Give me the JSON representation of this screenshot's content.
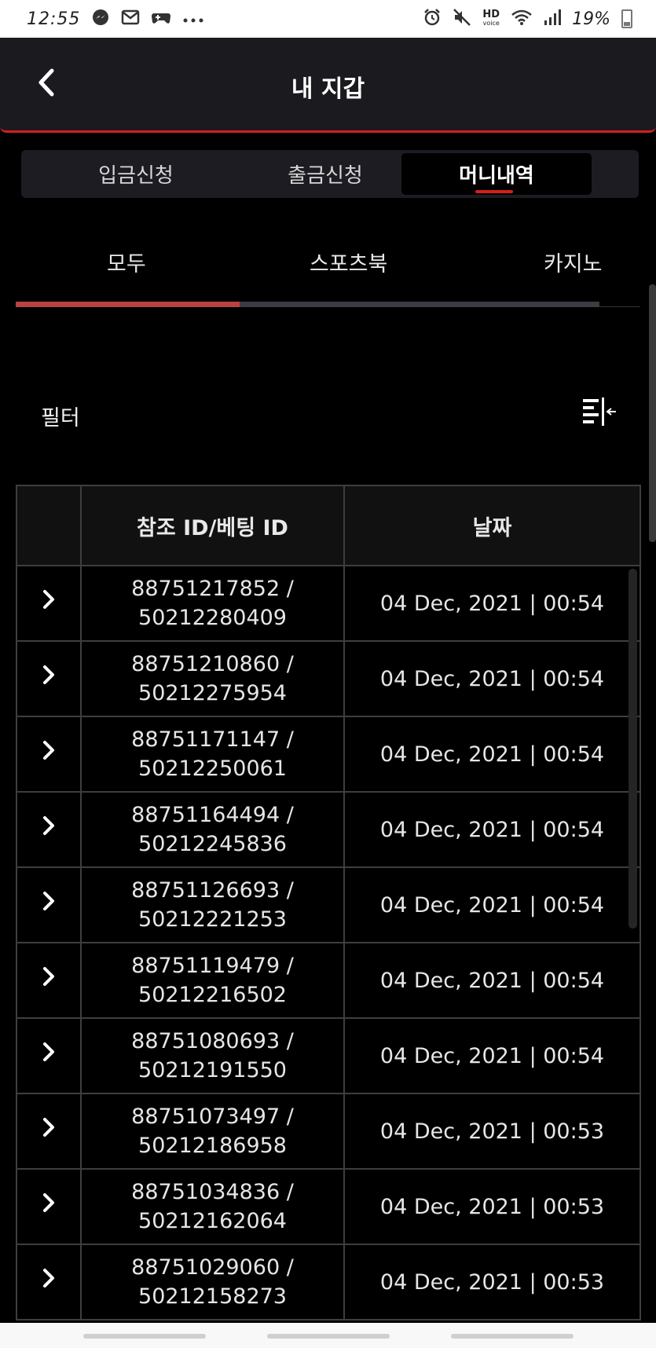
{
  "status_bar": {
    "time": "12:55",
    "hd_label": "HD",
    "voice_label": "voice",
    "battery": "19%"
  },
  "header": {
    "title": "내 지갑"
  },
  "top_tabs": {
    "deposit": "입금신청",
    "withdraw": "출금신청",
    "money_history": "머니내역",
    "active": "머니내역"
  },
  "sub_tabs": {
    "all": "모두",
    "sportsbook": "스포츠북",
    "casino": "카지노",
    "active": "모두"
  },
  "filter": {
    "label": "필터"
  },
  "table": {
    "headers": {
      "ref": "참조 ID/베팅 ID",
      "date": "날짜"
    },
    "rows": [
      {
        "ref": "88751217852 /",
        "bet": "50212280409",
        "date": "04 Dec, 2021 | 00:54"
      },
      {
        "ref": "88751210860 /",
        "bet": "50212275954",
        "date": "04 Dec, 2021 | 00:54"
      },
      {
        "ref": "88751171147 /",
        "bet": "50212250061",
        "date": "04 Dec, 2021 | 00:54"
      },
      {
        "ref": "88751164494 /",
        "bet": "50212245836",
        "date": "04 Dec, 2021 | 00:54"
      },
      {
        "ref": "88751126693 /",
        "bet": "50212221253",
        "date": "04 Dec, 2021 | 00:54"
      },
      {
        "ref": "88751119479 /",
        "bet": "50212216502",
        "date": "04 Dec, 2021 | 00:54"
      },
      {
        "ref": "88751080693 /",
        "bet": "50212191550",
        "date": "04 Dec, 2021 | 00:54"
      },
      {
        "ref": "88751073497 /",
        "bet": "50212186958",
        "date": "04 Dec, 2021 | 00:53"
      },
      {
        "ref": "88751034836 /",
        "bet": "50212162064",
        "date": "04 Dec, 2021 | 00:53"
      },
      {
        "ref": "88751029060 /",
        "bet": "50212158273",
        "date": "04 Dec, 2021 | 00:53"
      }
    ]
  },
  "icons": {
    "back": "chevron-left-icon",
    "row_expand": "chevron-right-icon",
    "filter": "filter-collapse-icon"
  },
  "colors": {
    "accent": "#d41f1f",
    "tab_indicator": "#b84242",
    "header_bg": "#1a1a1f",
    "background": "#000000"
  }
}
